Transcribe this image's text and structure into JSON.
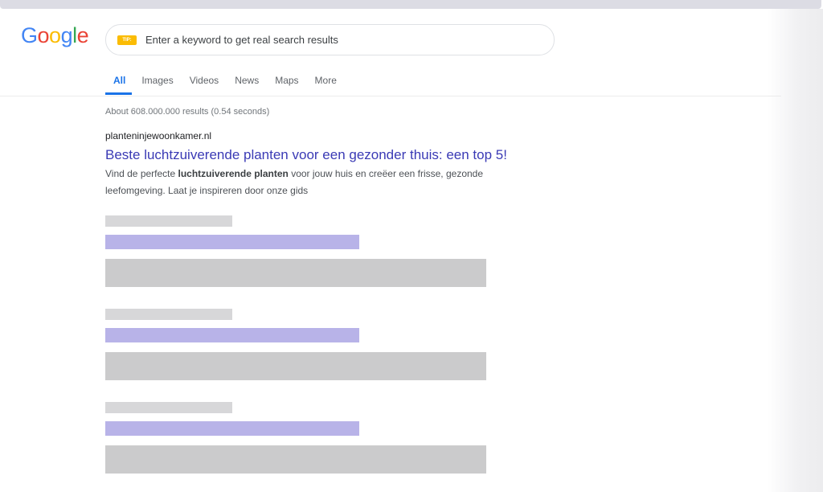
{
  "logo": {
    "letters": [
      "G",
      "o",
      "o",
      "g",
      "l",
      "e"
    ],
    "colors": [
      "#4285F4",
      "#EA4335",
      "#FBBC05",
      "#4285F4",
      "#34A853",
      "#EA4335"
    ]
  },
  "search": {
    "badge": "TIP:",
    "text": "Enter a keyword to get real search results"
  },
  "tabs": [
    {
      "label": "All"
    },
    {
      "label": "Images"
    },
    {
      "label": "Videos"
    },
    {
      "label": "News"
    },
    {
      "label": "Maps"
    },
    {
      "label": "More"
    }
  ],
  "results_stats": "About 608.000.000 results (0.54 seconds)",
  "result": {
    "url": "planteninjewoonkamer.nl",
    "title": "Beste luchtzuiverende planten voor een gezonder thuis: een top 5!",
    "snippet_before": "Vind de perfecte ",
    "snippet_bold": "luchtzuiverende planten",
    "snippet_after": " voor jouw huis en creëer een frisse, gezonde leefomgeving. Laat je inspireren door onze gids"
  },
  "colors": {
    "link": "#3a3ab5",
    "active_tab": "#1a73e8",
    "placeholder_title": "#b8b3e8",
    "placeholder_gray": "#cbcbcc"
  }
}
